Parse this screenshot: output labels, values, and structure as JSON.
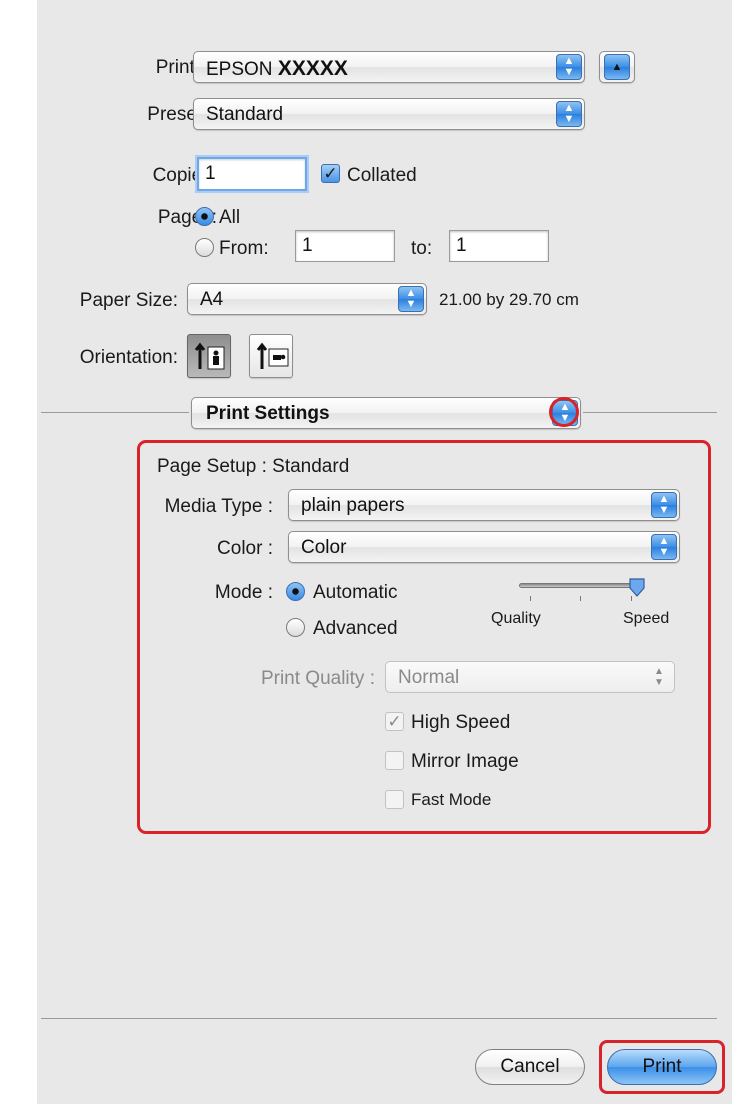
{
  "printer": {
    "label": "Printer:",
    "value_prefix": "EPSON",
    "value_model": "XXXXX"
  },
  "presets": {
    "label": "Presets:",
    "value": "Standard"
  },
  "copies": {
    "label": "Copies:",
    "value": "1",
    "collated_label": "Collated",
    "collated": true
  },
  "pages": {
    "label": "Pages:",
    "all_label": "All",
    "from_label": "From:",
    "from_value": "1",
    "to_label": "to:",
    "to_value": "1",
    "selected": "All"
  },
  "paper_size": {
    "label": "Paper Size:",
    "value": "A4",
    "dimensions": "21.00 by 29.70 cm"
  },
  "orientation": {
    "label": "Orientation:",
    "selected": "portrait"
  },
  "panel_popup": {
    "value": "Print Settings"
  },
  "settings": {
    "page_setup": "Page Setup : Standard",
    "media_type_label": "Media Type :",
    "media_type_value": "plain papers",
    "color_label": "Color :",
    "color_value": "Color",
    "mode_label": "Mode :",
    "mode_automatic": "Automatic",
    "mode_advanced": "Advanced",
    "mode_selected": "Automatic",
    "slider_left": "Quality",
    "slider_right": "Speed",
    "slider_value": 1.0,
    "print_quality_label": "Print Quality :",
    "print_quality_value": "Normal",
    "high_speed_label": "High Speed",
    "high_speed_checked": true,
    "mirror_image_label": "Mirror Image",
    "fast_mode_label": "Fast Mode"
  },
  "buttons": {
    "cancel": "Cancel",
    "print": "Print"
  },
  "colors": {
    "highlight": "#d8232a",
    "accent": "#3b8fe8"
  }
}
